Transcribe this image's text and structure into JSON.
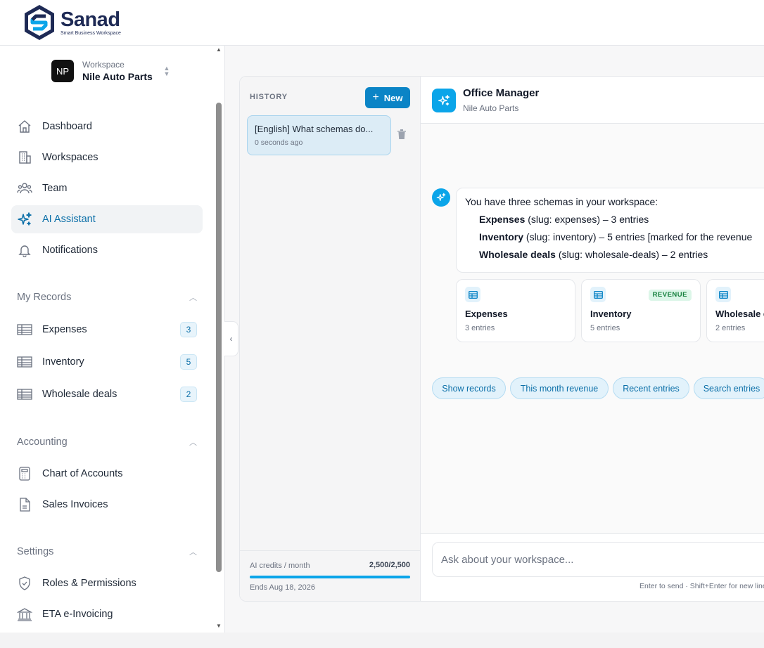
{
  "brand": {
    "name": "Sanad",
    "tagline": "Smart Business Workspace"
  },
  "workspace": {
    "initials": "NP",
    "label": "Workspace",
    "name": "Nile Auto Parts"
  },
  "nav": {
    "main": [
      {
        "label": "Dashboard",
        "icon": "home-icon"
      },
      {
        "label": "Workspaces",
        "icon": "building-icon"
      },
      {
        "label": "Team",
        "icon": "users-icon"
      },
      {
        "label": "AI Assistant",
        "icon": "sparkles-icon",
        "active": true
      },
      {
        "label": "Notifications",
        "icon": "bell-icon"
      }
    ],
    "records_title": "My Records",
    "records": [
      {
        "label": "Expenses",
        "count": "3"
      },
      {
        "label": "Inventory",
        "count": "5"
      },
      {
        "label": "Wholesale deals",
        "count": "2"
      }
    ],
    "accounting_title": "Accounting",
    "accounting": [
      {
        "label": "Chart of Accounts"
      },
      {
        "label": "Sales Invoices"
      }
    ],
    "settings_title": "Settings",
    "settings": [
      {
        "label": "Roles & Permissions"
      },
      {
        "label": "ETA e-Invoicing"
      }
    ]
  },
  "history": {
    "title": "HISTORY",
    "new_label": "New",
    "items": [
      {
        "title": "[English] What schemas do...",
        "time": "0 seconds ago"
      }
    ],
    "credits_label": "AI credits / month",
    "credits_value": "2,500/2,500",
    "credits_fraction": 1.0,
    "credits_ends": "Ends Aug 18, 2026"
  },
  "chat": {
    "assistant_name": "Office Manager",
    "assistant_sub": "Nile Auto Parts",
    "message": {
      "intro": "You have three schemas in your workspace:",
      "items": [
        {
          "name": "Expenses",
          "detail": " (slug: expenses) – 3 entries"
        },
        {
          "name": "Inventory",
          "detail": " (slug: inventory) – 5 entries [marked for the revenue"
        },
        {
          "name": "Wholesale deals",
          "detail": " (slug: wholesale-deals) – 2 entries"
        }
      ]
    },
    "cards": [
      {
        "title": "Expenses",
        "sub": "3 entries",
        "tag": ""
      },
      {
        "title": "Inventory",
        "sub": "5 entries",
        "tag": "REVENUE"
      },
      {
        "title": "Wholesale deals",
        "sub": "2 entries",
        "tag": ""
      }
    ],
    "chips": [
      "Show records",
      "This month revenue",
      "Recent entries",
      "Search entries"
    ],
    "input_placeholder": "Ask about your workspace...",
    "hint": "Enter to send · Shift+Enter for new line"
  },
  "colors": {
    "accent": "#0b84c6",
    "accent_light": "#e2f2fb",
    "brand_dark": "#1e2a55"
  }
}
